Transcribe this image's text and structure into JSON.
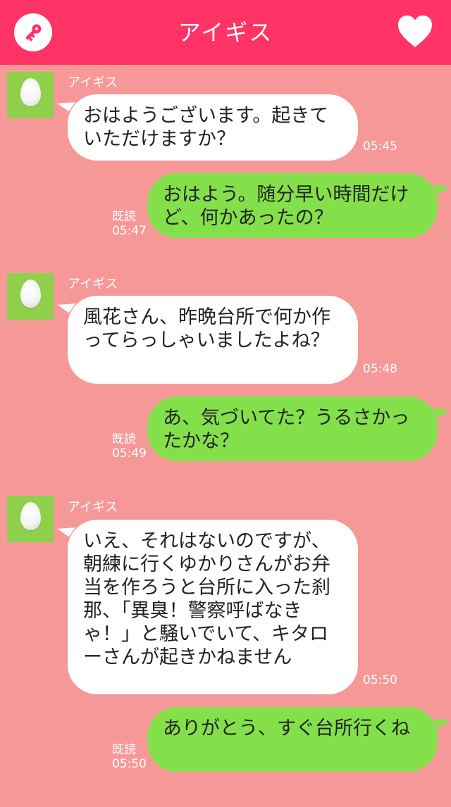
{
  "header": {
    "title": "アイギス",
    "left_icon": "key-icon",
    "right_icon": "heart-icon",
    "color": "#ff3366"
  },
  "colors": {
    "background": "#f79898",
    "incoming_bubble": "#ffffff",
    "outgoing_bubble": "#84e04a",
    "avatar": "#8ed04a"
  },
  "messages": [
    {
      "sender": "アイギス",
      "text": "おはようございます。起きていただけますか？",
      "time": "05:45"
    },
    {
      "text": "おはよう。随分早い時間だけど、何かあったの？",
      "read": "既読",
      "time": "05:47"
    },
    {
      "sender": "アイギス",
      "text": "風花さん、昨晩台所で何か作ってらっしゃいましたよね？",
      "time": "05:48"
    },
    {
      "text": "あ、気づいてた？うるさかったかな？",
      "read": "既読",
      "time": "05:49"
    },
    {
      "sender": "アイギス",
      "text": "いえ、それはないのですが、朝練に行くゆかりさんがお弁当を作ろうと台所に入った刹那、「異臭！警察呼ばなきゃ！」と騒いでいて、キタローさんが起きかねません",
      "time": "05:50"
    },
    {
      "text": "ありがとう、すぐ台所行くね",
      "read": "既読",
      "time": "05:50"
    }
  ]
}
